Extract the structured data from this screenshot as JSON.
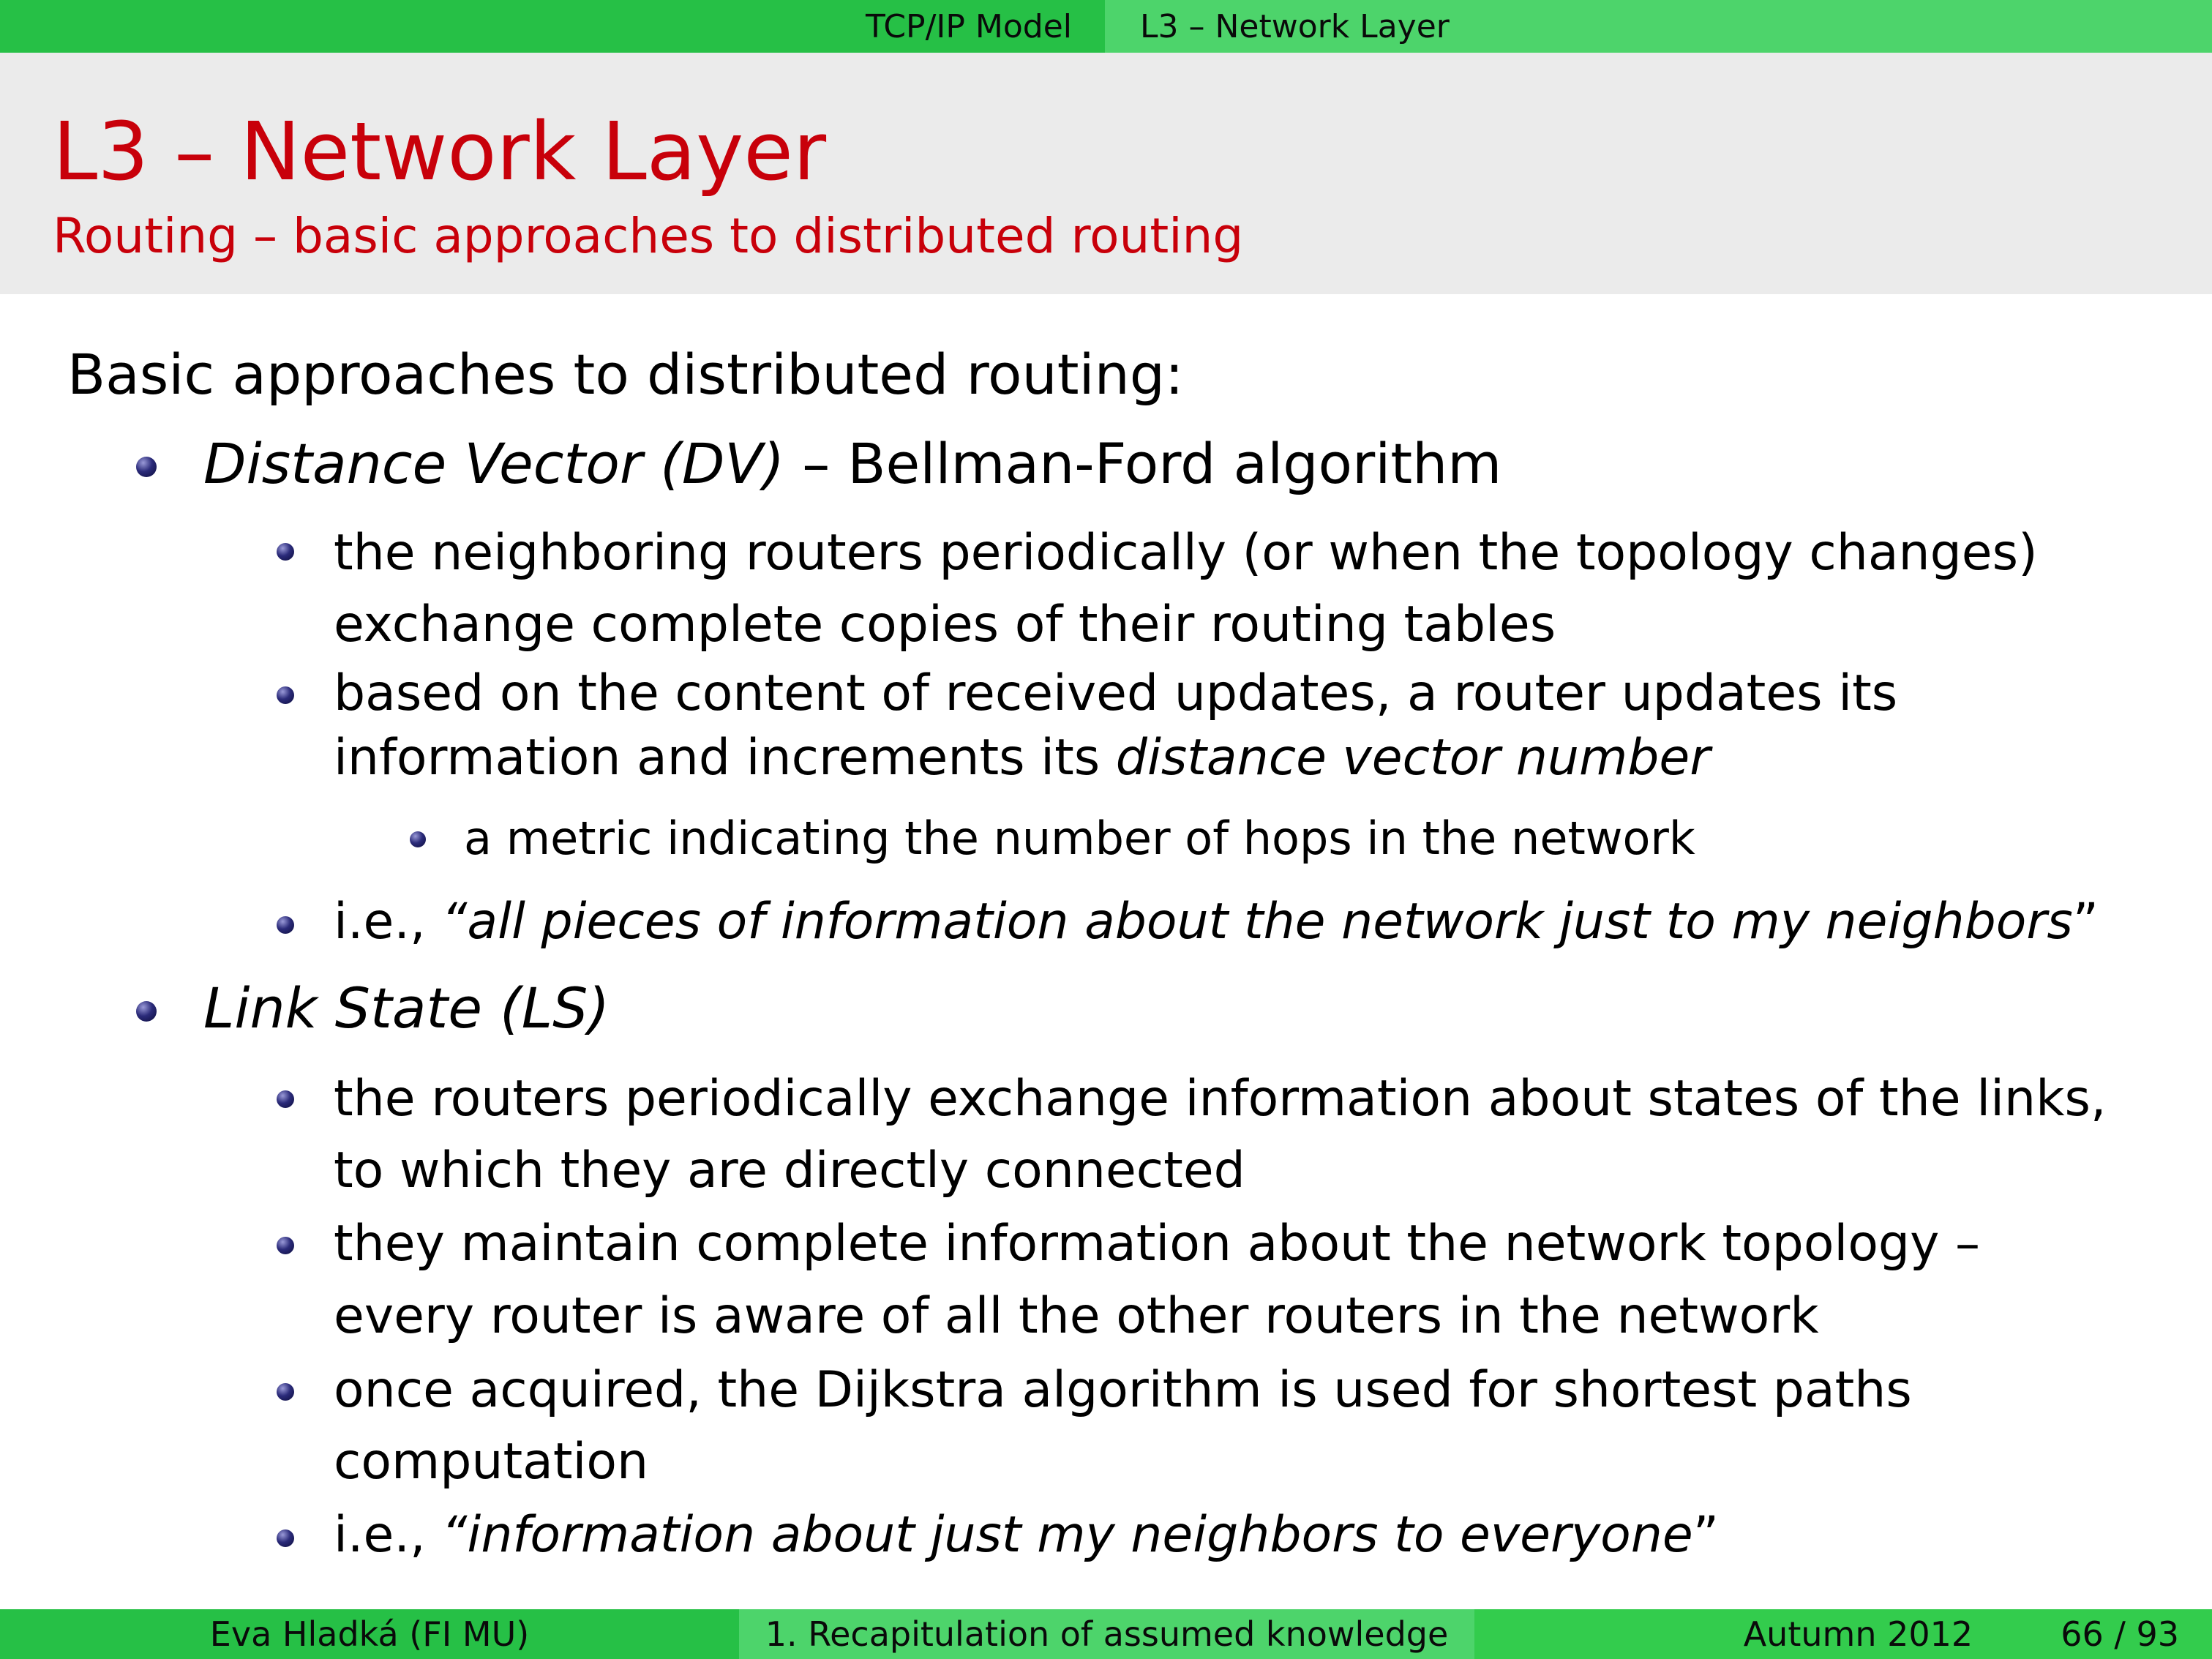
{
  "nav": {
    "section": "TCP/IP Model",
    "subsection": "L3 – Network Layer"
  },
  "slide": {
    "title": "L3 – Network Layer",
    "subtitle": "Routing – basic approaches to distributed routing"
  },
  "body": {
    "intro": "Basic approaches to distributed routing:",
    "dv": {
      "name": "Distance Vector (DV)",
      "rest": " – Bellman-Ford algorithm",
      "p1_line1": "the neighboring routers periodically (or when the topology changes)",
      "p1_line2": "exchange complete copies of their routing tables",
      "p2_line1": "based on the content of received updates, a router updates its",
      "p2_line2_plain": "information and increments its ",
      "p2_line2_em": "distance vector number",
      "p2_sub": "a metric indicating the number of hops in the network",
      "p3_plain": "i.e., ",
      "p3_em": "“all pieces of information about the network just to my neighbors",
      "p3_close": "”"
    },
    "ls": {
      "name": "Link State (LS)",
      "p1_line1": "the routers periodically exchange information about states of the links,",
      "p1_line2": "to which they are directly connected",
      "p2_line1": "they maintain complete information about the network topology –",
      "p2_line2": "every router is aware of all the other routers in the network",
      "p3_line1": "once acquired, the Dijkstra algorithm is used for shortest paths",
      "p3_line2": "computation",
      "p4_plain": "i.e., ",
      "p4_em": "“information about just my neighbors to everyone",
      "p4_close": "”"
    }
  },
  "footer": {
    "author": "Eva Hladká  (FI MU)",
    "talk": "1. Recapitulation of assumed knowledge",
    "date": "Autumn 2012",
    "page": "66 / 93"
  }
}
